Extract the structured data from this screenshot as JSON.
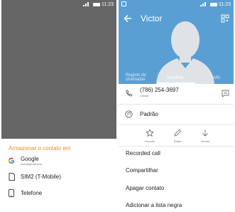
{
  "status_bar": {
    "time": "11:23"
  },
  "left_screen": {
    "sheet_title": "Armazenar o contato em",
    "accounts": [
      {
        "name": "Google",
        "sub": "user@gmail.com"
      },
      {
        "name": "SIM2 (T-Mobile)",
        "sub": ""
      },
      {
        "name": "Telefone",
        "sub": ""
      }
    ]
  },
  "right_screen": {
    "contact_name": "Victor",
    "tabs": [
      {
        "label": "Registo de chamadas"
      },
      {
        "label": "Detalhes"
      },
      {
        "label": "SMS"
      }
    ],
    "phone": {
      "number": "(786) 254-3697",
      "type": "Celular"
    },
    "ringtone": "Padrão",
    "actions": [
      {
        "label": "Favorito"
      },
      {
        "label": "Editar"
      },
      {
        "label": "Vechar"
      }
    ],
    "menu": [
      "Recorded call",
      "Compartilhar",
      "Apagar contato",
      "Adicionar a lista negra"
    ]
  },
  "colors": {
    "header_blue": "#5a9fd4",
    "accent_orange": "#f08a24",
    "overlay_gray": "#666666"
  }
}
